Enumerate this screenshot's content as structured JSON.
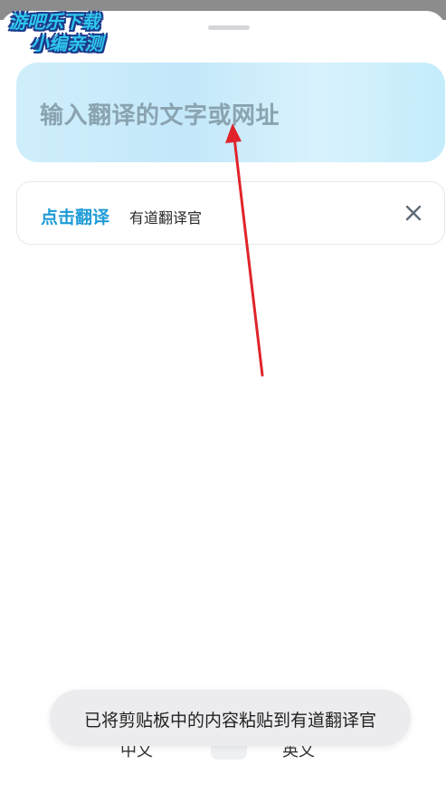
{
  "watermark": {
    "line1": "游吧乐下载",
    "line2": "小编亲测"
  },
  "input": {
    "placeholder": "输入翻译的文字或网址"
  },
  "suggestion": {
    "action_label": "点击翻译",
    "source_text": "有道翻译官",
    "close_icon": "close-icon"
  },
  "lang_bar": {
    "source": "中文",
    "target": "英文",
    "swap_icon": "swap-icon"
  },
  "toast": {
    "message": "已将剪贴板中的内容粘贴到有道翻译官"
  },
  "colors": {
    "accent": "#1e9bd7",
    "arrow": "#e0242a",
    "input_bg": "#cfeefc"
  }
}
